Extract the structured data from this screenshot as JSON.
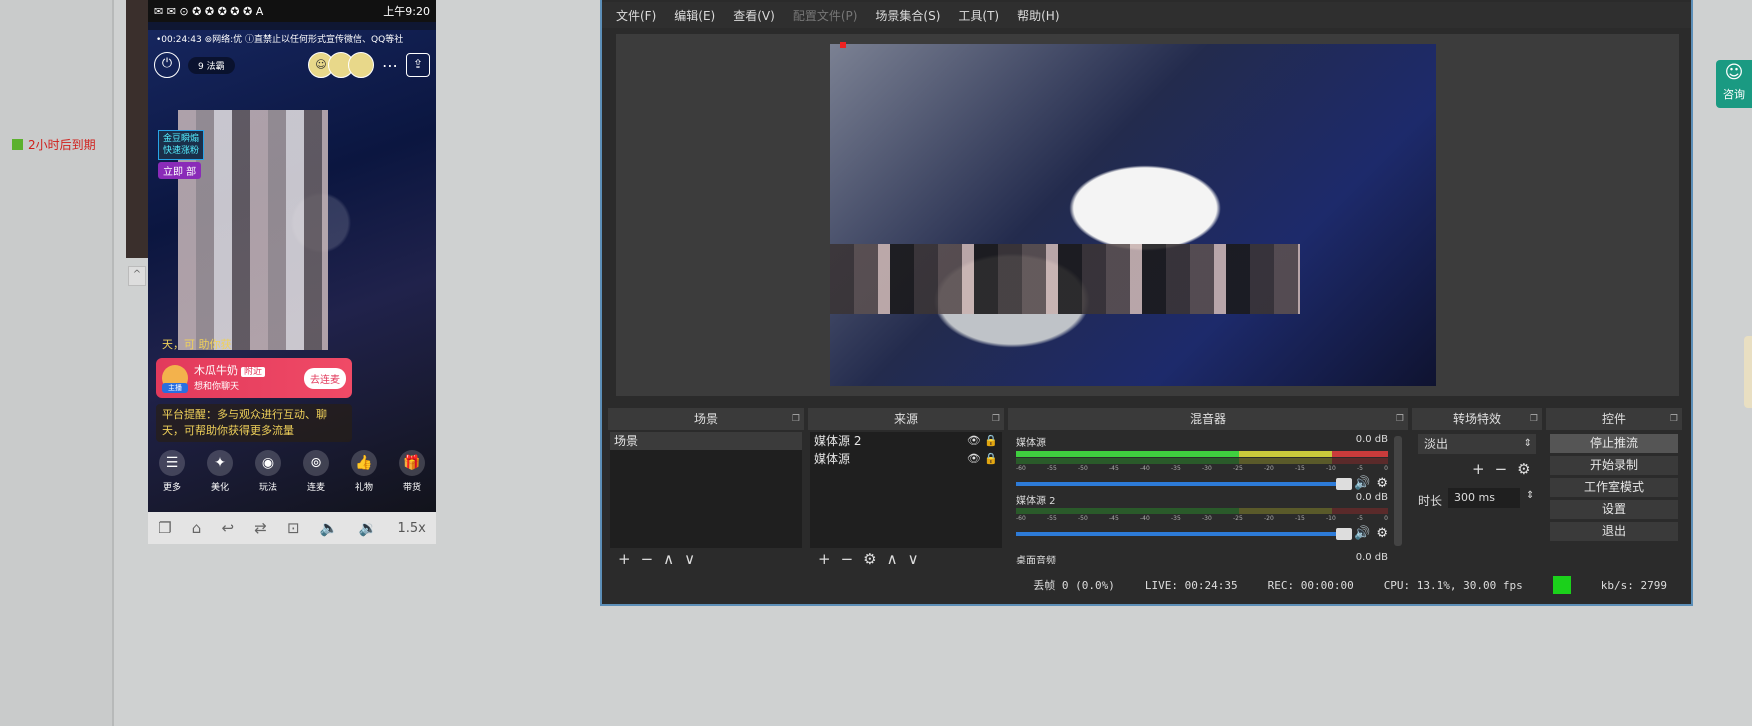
{
  "left": {
    "expiry_text": "2小时后到期"
  },
  "phone": {
    "status_left": "✉ ✉ ⊙ ✪ ✪ ✪ ✪ ✪ A",
    "status_right": "上午9:20",
    "live_info": "•00:24:43 ⊚网络:优  ⓘ直禁止以任何形式宣传微信、QQ等社",
    "fans_label": "9 法霸",
    "coin_label": "☺",
    "badge_line1": "金豆瞬煽",
    "badge_line2": "快速涨粉",
    "badge_tag": "立即 部",
    "tip_top": "天，可 助你获",
    "invite_name": "木瓜牛奶",
    "invite_near": "附近",
    "invite_sub": "想和你聊天",
    "invite_tag": "主播",
    "invite_go": "去连麦",
    "platform_tip": "平台提醒：多与观众进行互动、聊天，可帮助你获得更多流量",
    "bottom_items": [
      {
        "icon": "☰",
        "label": "更多"
      },
      {
        "icon": "✦",
        "label": "美化"
      },
      {
        "icon": "◉",
        "label": "玩法"
      },
      {
        "icon": "⊚",
        "label": "连麦"
      },
      {
        "icon": "👍",
        "label": "礼物"
      },
      {
        "icon": "🎁",
        "label": "带货"
      }
    ],
    "zoom": "1.5x"
  },
  "obs": {
    "menu": [
      "文件(F)",
      "编辑(E)",
      "查看(V)",
      "配置文件(P)",
      "场景集合(S)",
      "工具(T)",
      "帮助(H)"
    ],
    "docks": {
      "scenes": {
        "title": "场景",
        "items": [
          "场景"
        ]
      },
      "sources": {
        "title": "来源",
        "items": [
          "媒体源 2",
          "媒体源"
        ]
      },
      "mixer": {
        "title": "混音器",
        "channels": [
          {
            "name": "媒体源",
            "db": "0.0 dB"
          },
          {
            "name": "媒体源 2",
            "db": "0.0 dB"
          },
          {
            "name": "桌面音频",
            "db": "0.0 dB"
          }
        ],
        "ticks": [
          "-60",
          "-55",
          "-50",
          "-45",
          "-40",
          "-35",
          "-30",
          "-25",
          "-20",
          "-15",
          "-10",
          "-5",
          "0"
        ]
      },
      "transitions": {
        "title": "转场特效",
        "selected": "淡出",
        "duration_label": "时长",
        "duration_value": "300 ms"
      },
      "controls": {
        "title": "控件",
        "buttons": [
          "停止推流",
          "开始录制",
          "工作室模式",
          "设置",
          "退出"
        ]
      }
    },
    "status": {
      "dropped": "丢帧 0 (0.0%)",
      "live": "LIVE: 00:24:35",
      "rec": "REC: 00:00:00",
      "cpu": "CPU: 13.1%, 30.00 fps",
      "kbps": "kb/s: 2799"
    }
  },
  "consult_label": "咨询"
}
